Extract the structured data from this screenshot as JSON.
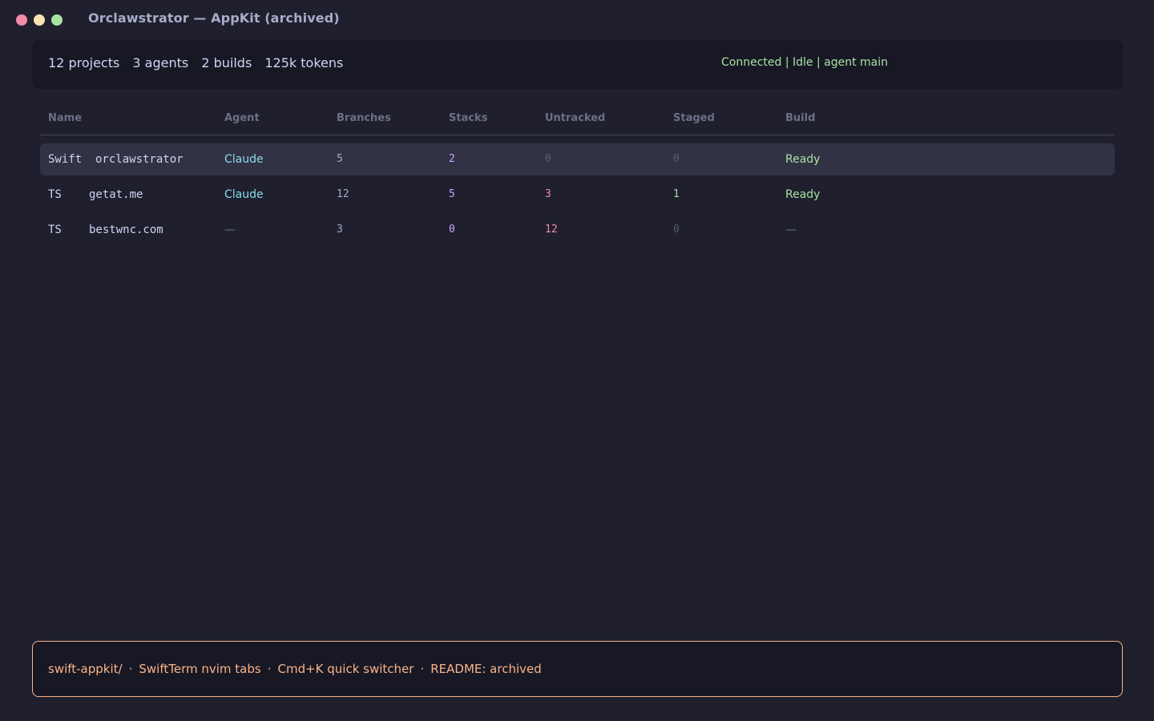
{
  "window": {
    "title": "Orclawstrator — AppKit (archived)"
  },
  "stats": {
    "projects": "12 projects",
    "agents": "3 agents",
    "builds": "2 builds",
    "tokens": "125k tokens",
    "status": "Connected | Idle | agent main"
  },
  "table": {
    "headers": {
      "name": "Name",
      "agent": "Agent",
      "branches": "Branches",
      "stacks": "Stacks",
      "untracked": "Untracked",
      "staged": "Staged",
      "build": "Build"
    },
    "rows": [
      {
        "lang": "Swift",
        "name": "orclawstrator",
        "agent": "Claude",
        "branches": "5",
        "stacks": "2",
        "untracked": "0",
        "staged": "0",
        "build": "Ready"
      },
      {
        "lang": "TS",
        "name": "getat.me",
        "agent": "Claude",
        "branches": "12",
        "stacks": "5",
        "untracked": "3",
        "staged": "1",
        "build": "Ready"
      },
      {
        "lang": "TS",
        "name": "bestwnc.com",
        "agent": "—",
        "branches": "3",
        "stacks": "0",
        "untracked": "12",
        "staged": "0",
        "build": "—"
      }
    ]
  },
  "footer": {
    "items": [
      "swift-appkit/",
      "SwiftTerm nvim tabs",
      "Cmd+K quick switcher",
      "README: archived"
    ],
    "separator": "·"
  },
  "colors": {
    "background": "#1f1f2e",
    "accent_green": "#a6e3a1",
    "accent_pink": "#f38ba8",
    "accent_orange": "#fab387",
    "accent_cyan": "#89dceb",
    "accent_purple": "#cba6f7"
  }
}
